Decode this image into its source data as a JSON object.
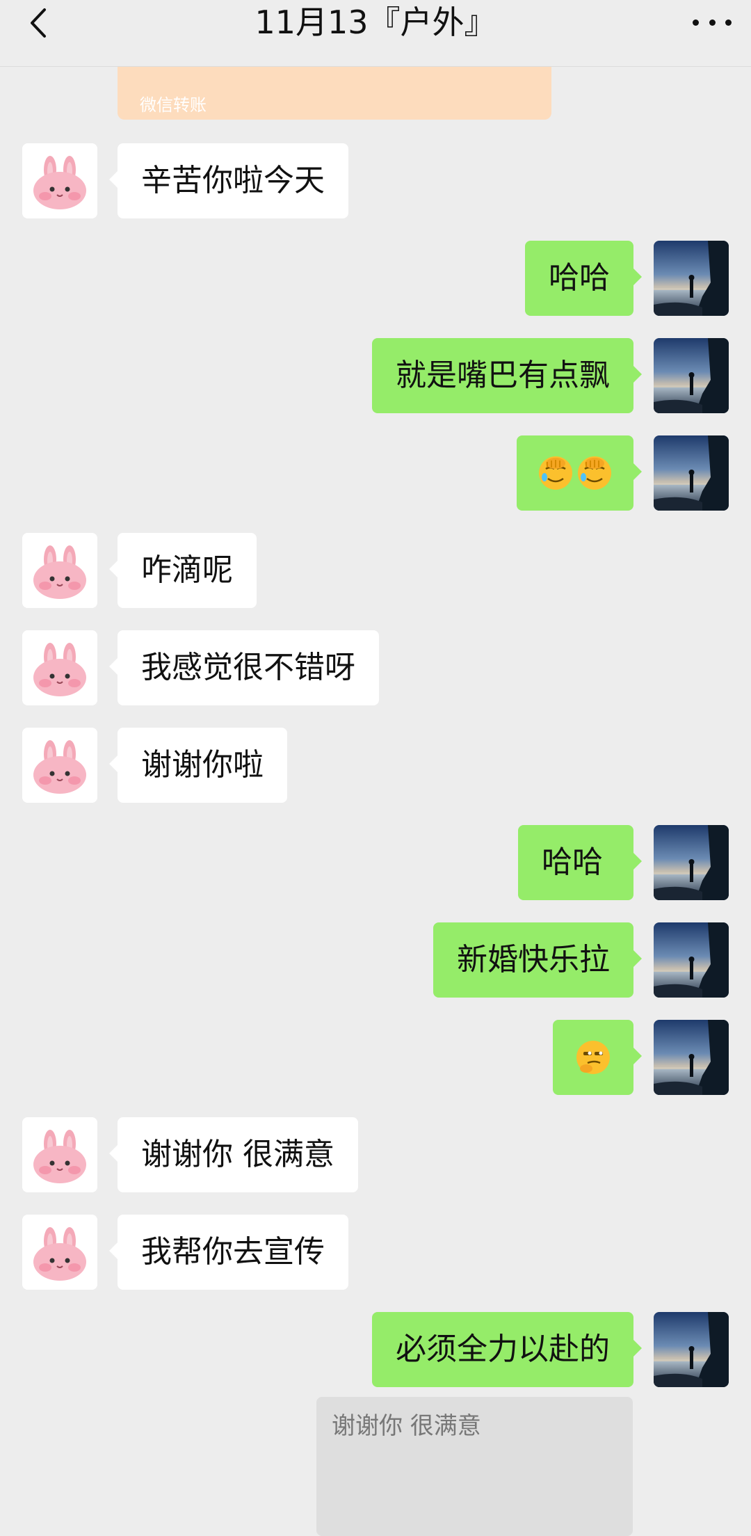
{
  "header": {
    "title": "11月13『户外』",
    "back_icon": "chevron-left-icon",
    "more_icon": "more-dots-icon"
  },
  "transfer": {
    "label": "微信转账",
    "color": "#fddcbd"
  },
  "colors": {
    "background": "#ededed",
    "self_bubble": "#95ec69",
    "other_bubble": "#ffffff"
  },
  "messages": [
    {
      "side": "left",
      "text": "辛苦你啦今天"
    },
    {
      "side": "right",
      "text": "哈哈"
    },
    {
      "side": "right",
      "text": "就是嘴巴有点飘"
    },
    {
      "side": "right",
      "emoji": [
        "facepalm-emoji",
        "facepalm-emoji"
      ]
    },
    {
      "side": "left",
      "text": "咋滴呢"
    },
    {
      "side": "left",
      "text": "我感觉很不错呀"
    },
    {
      "side": "left",
      "text": "谢谢你啦"
    },
    {
      "side": "right",
      "text": "哈哈"
    },
    {
      "side": "right",
      "text": "新婚快乐拉"
    },
    {
      "side": "right",
      "emoji": [
        "sly-smirk-emoji"
      ]
    },
    {
      "side": "left",
      "text": "谢谢你 很满意"
    },
    {
      "side": "left",
      "text": "我帮你去宣传"
    },
    {
      "side": "right",
      "text": "必须全力以赴的"
    }
  ],
  "quote": {
    "text": "谢谢你 很满意"
  },
  "avatars": {
    "other": "bunny-avatar",
    "self": "seaside-silhouette-avatar"
  }
}
